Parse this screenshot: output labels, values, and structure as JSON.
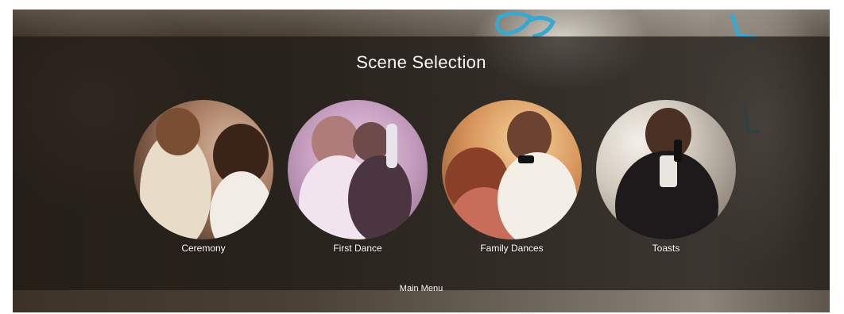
{
  "screen": {
    "title": "Scene Selection",
    "main_menu_label": "Main Menu"
  },
  "scenes": [
    {
      "label": "Ceremony"
    },
    {
      "label": "First Dance"
    },
    {
      "label": "Family Dances"
    },
    {
      "label": "Toasts"
    }
  ],
  "colors": {
    "overlay": "#1c1814",
    "text": "#ffffff",
    "monogram_accent": "#3aa7cf"
  }
}
